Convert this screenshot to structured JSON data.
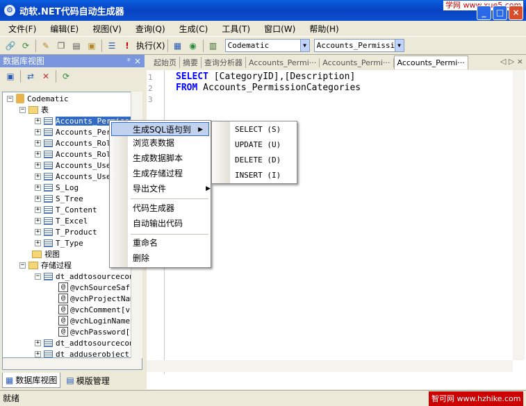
{
  "window": {
    "title": "动软.NET代码自动生成器",
    "watermark_top": "学网 www.xue5.com",
    "controls": [
      "_",
      "□",
      "×"
    ]
  },
  "menubar": {
    "items": [
      "文件(F)",
      "编辑(E)",
      "视图(V)",
      "查询(Q)",
      "生成(C)",
      "工具(T)",
      "窗口(W)",
      "帮助(H)"
    ]
  },
  "toolbar": {
    "execute_label": "执行(X)",
    "server_combo": "Codematic",
    "table_combo": "Accounts_Permissic"
  },
  "left_panel": {
    "title": "数据库视图",
    "pin": "ᵖ",
    "close": "×",
    "tree": {
      "root": "Codematic",
      "tables_folder": "表",
      "tables": [
        "Accounts_Permissi",
        "Accounts_Per",
        "Accounts_Rol",
        "Accounts_Rol",
        "Accounts_Use",
        "Accounts_Use",
        "S_Log",
        "S_Tree",
        "T_Content",
        "T_Excel",
        "T_Product",
        "T_Type"
      ],
      "views_folder": "视图",
      "procs_folder": "存储过程",
      "proc1": "dt_addtosourcecon",
      "params": [
        "@vchSourceSafe",
        "@vchProjectNam",
        "@vchComment[va",
        "@vchLoginName[",
        "@vchPassword[v"
      ],
      "proc2": "dt_addtosourcecon",
      "proc3": "dt_adduserobject"
    },
    "tabs": [
      "数据库视图",
      "模版管理"
    ]
  },
  "editor": {
    "tabs": [
      "起始页",
      "摘要",
      "查询分析器",
      "Accounts_Permi···",
      "Accounts_Permi···",
      "Accounts_Permi···"
    ],
    "tab_controls": "◁ ▷ ×",
    "line_numbers": [
      "1",
      "2",
      "3"
    ],
    "line1_kw": "SELECT",
    "line1_rest": " [CategoryID],[Description]",
    "line2_kw": "FROM",
    "line2_rest": " Accounts_PermissionCategories"
  },
  "context_menu": {
    "items": {
      "gen_sql": "生成SQL语句到",
      "browse": "浏览表数据",
      "gen_data_script": "生成数据脚本",
      "gen_proc": "生成存储过程",
      "export": "导出文件",
      "code_gen": "代码生成器",
      "auto_output": "自动输出代码",
      "rename": "重命名",
      "delete": "删除"
    },
    "submenu": [
      "SELECT (S)",
      "UPDATE (U)",
      "DELETE (D)",
      "INSERT (I)"
    ]
  },
  "statusbar": {
    "text": "就绪",
    "watermark": "智可网 www.hzhike.com"
  }
}
